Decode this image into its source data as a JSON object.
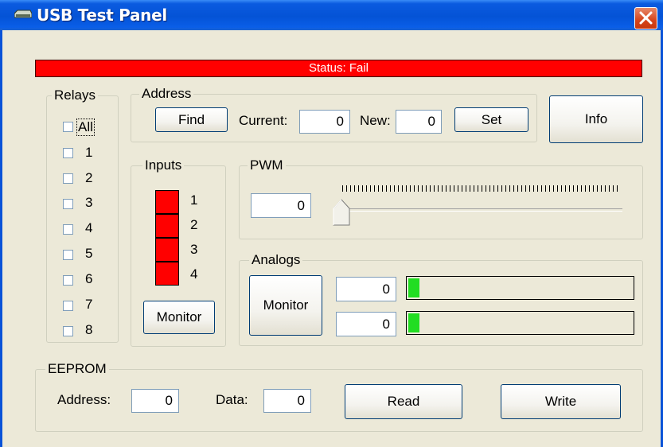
{
  "window": {
    "title": "USB Test Panel",
    "title_icon": "usb-device-icon",
    "close_icon": "close-icon"
  },
  "status": {
    "text": "Status:  Fail",
    "color": "#ff0000"
  },
  "relays": {
    "label": "Relays",
    "items": [
      "All",
      "1",
      "2",
      "3",
      "4",
      "5",
      "6",
      "7",
      "8"
    ]
  },
  "address": {
    "label": "Address",
    "find_label": "Find",
    "current_label": "Current:",
    "current_value": "0",
    "new_label": "New:",
    "new_value": "0",
    "set_label": "Set"
  },
  "info_label": "Info",
  "inputs": {
    "label": "Inputs",
    "items": [
      "1",
      "2",
      "3",
      "4"
    ],
    "led_color": "#ff0000",
    "monitor_label": "Monitor"
  },
  "pwm": {
    "label": "PWM",
    "value": "0",
    "slider_level": 0
  },
  "analogs": {
    "label": "Analogs",
    "monitor_label": "Monitor",
    "channels": [
      {
        "value": "0",
        "bar_color": "#22dd22"
      },
      {
        "value": "0",
        "bar_color": "#22dd22"
      }
    ]
  },
  "eeprom": {
    "label": "EEPROM",
    "address_label": "Address:",
    "address_value": "0",
    "data_label": "Data:",
    "data_value": "0",
    "read_label": "Read",
    "write_label": "Write"
  }
}
